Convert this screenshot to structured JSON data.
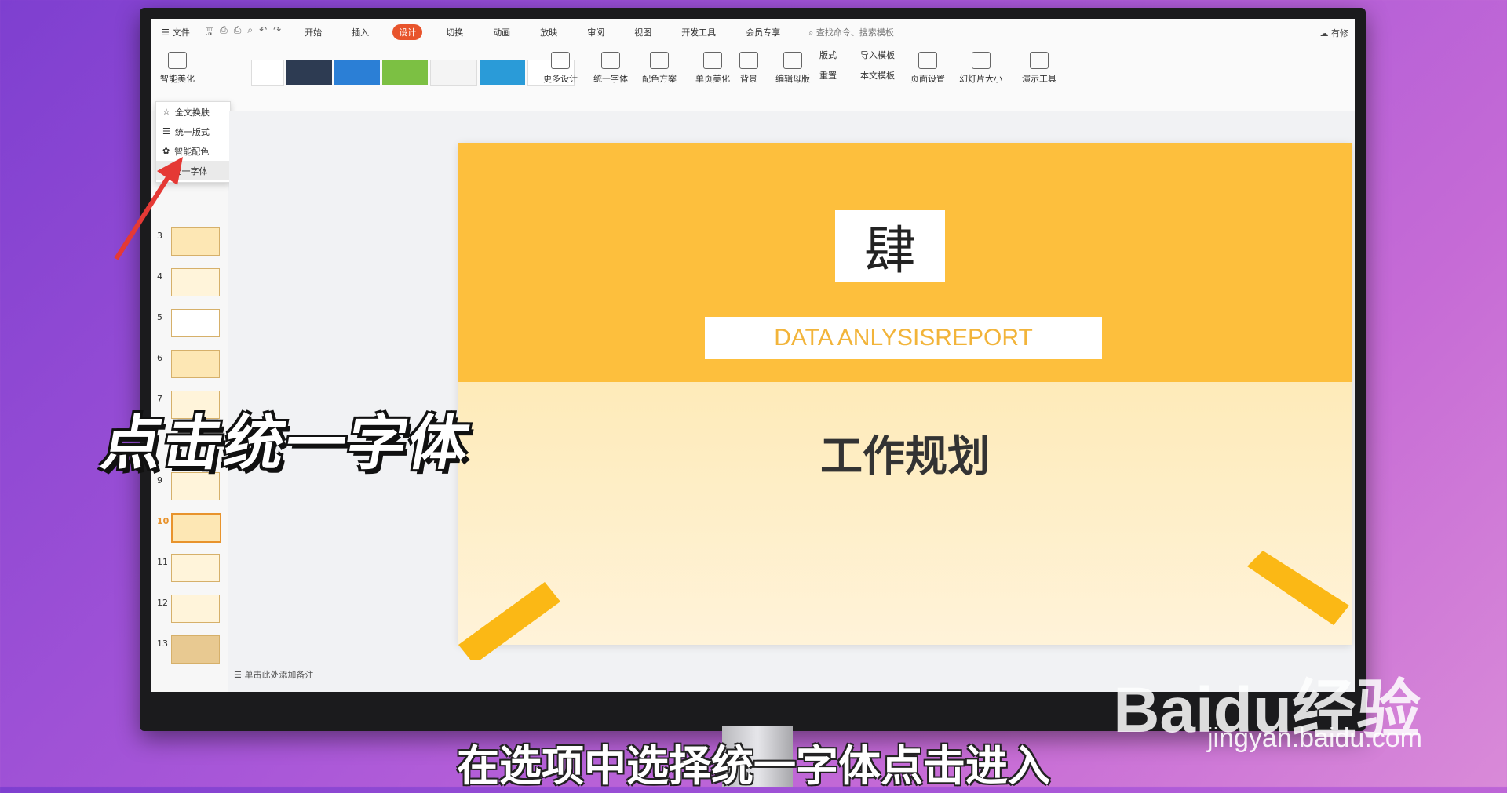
{
  "menu": {
    "file_label": "文件",
    "tabs": [
      "开始",
      "插入",
      "设计",
      "切换",
      "动画",
      "放映",
      "审阅",
      "视图",
      "开发工具",
      "会员专享"
    ],
    "active_tab": "设计",
    "search_placeholder": "查找命令、搜索模板",
    "cloud_label": "有修"
  },
  "ribbon": {
    "smart_beautify": "智能美化",
    "more_design": "更多设计",
    "unify_font": "统一字体",
    "color_scheme": "配色方案",
    "single_page_beautify": "单页美化",
    "background": "背景",
    "edit_master": "编辑母版",
    "layout": "版式",
    "reset": "重置",
    "import_template": "导入模板",
    "this_template": "本文模板",
    "page_setup": "页面设置",
    "slide_size": "幻灯片大小",
    "presentation_tools": "演示工具"
  },
  "dropdown": {
    "items": [
      "全文换肤",
      "统一版式",
      "智能配色",
      "统一字体"
    ],
    "hovered": "统一字体"
  },
  "slides_panel": {
    "numbers": [
      "3",
      "4",
      "5",
      "6",
      "7",
      "9",
      "10",
      "11",
      "12",
      "13"
    ],
    "selected": "10"
  },
  "slide": {
    "badge_char": "肆",
    "subtitle": "DATA ANLYSISREPORT",
    "title": "工作规划",
    "notes_placeholder": "单击此处添加备注"
  },
  "overlay": {
    "instruction": "点击统一字体",
    "caption": "在选项中选择统一字体点击进入",
    "watermark": "Baidu经验",
    "watermark_url": "jingyan.baidu.com"
  }
}
